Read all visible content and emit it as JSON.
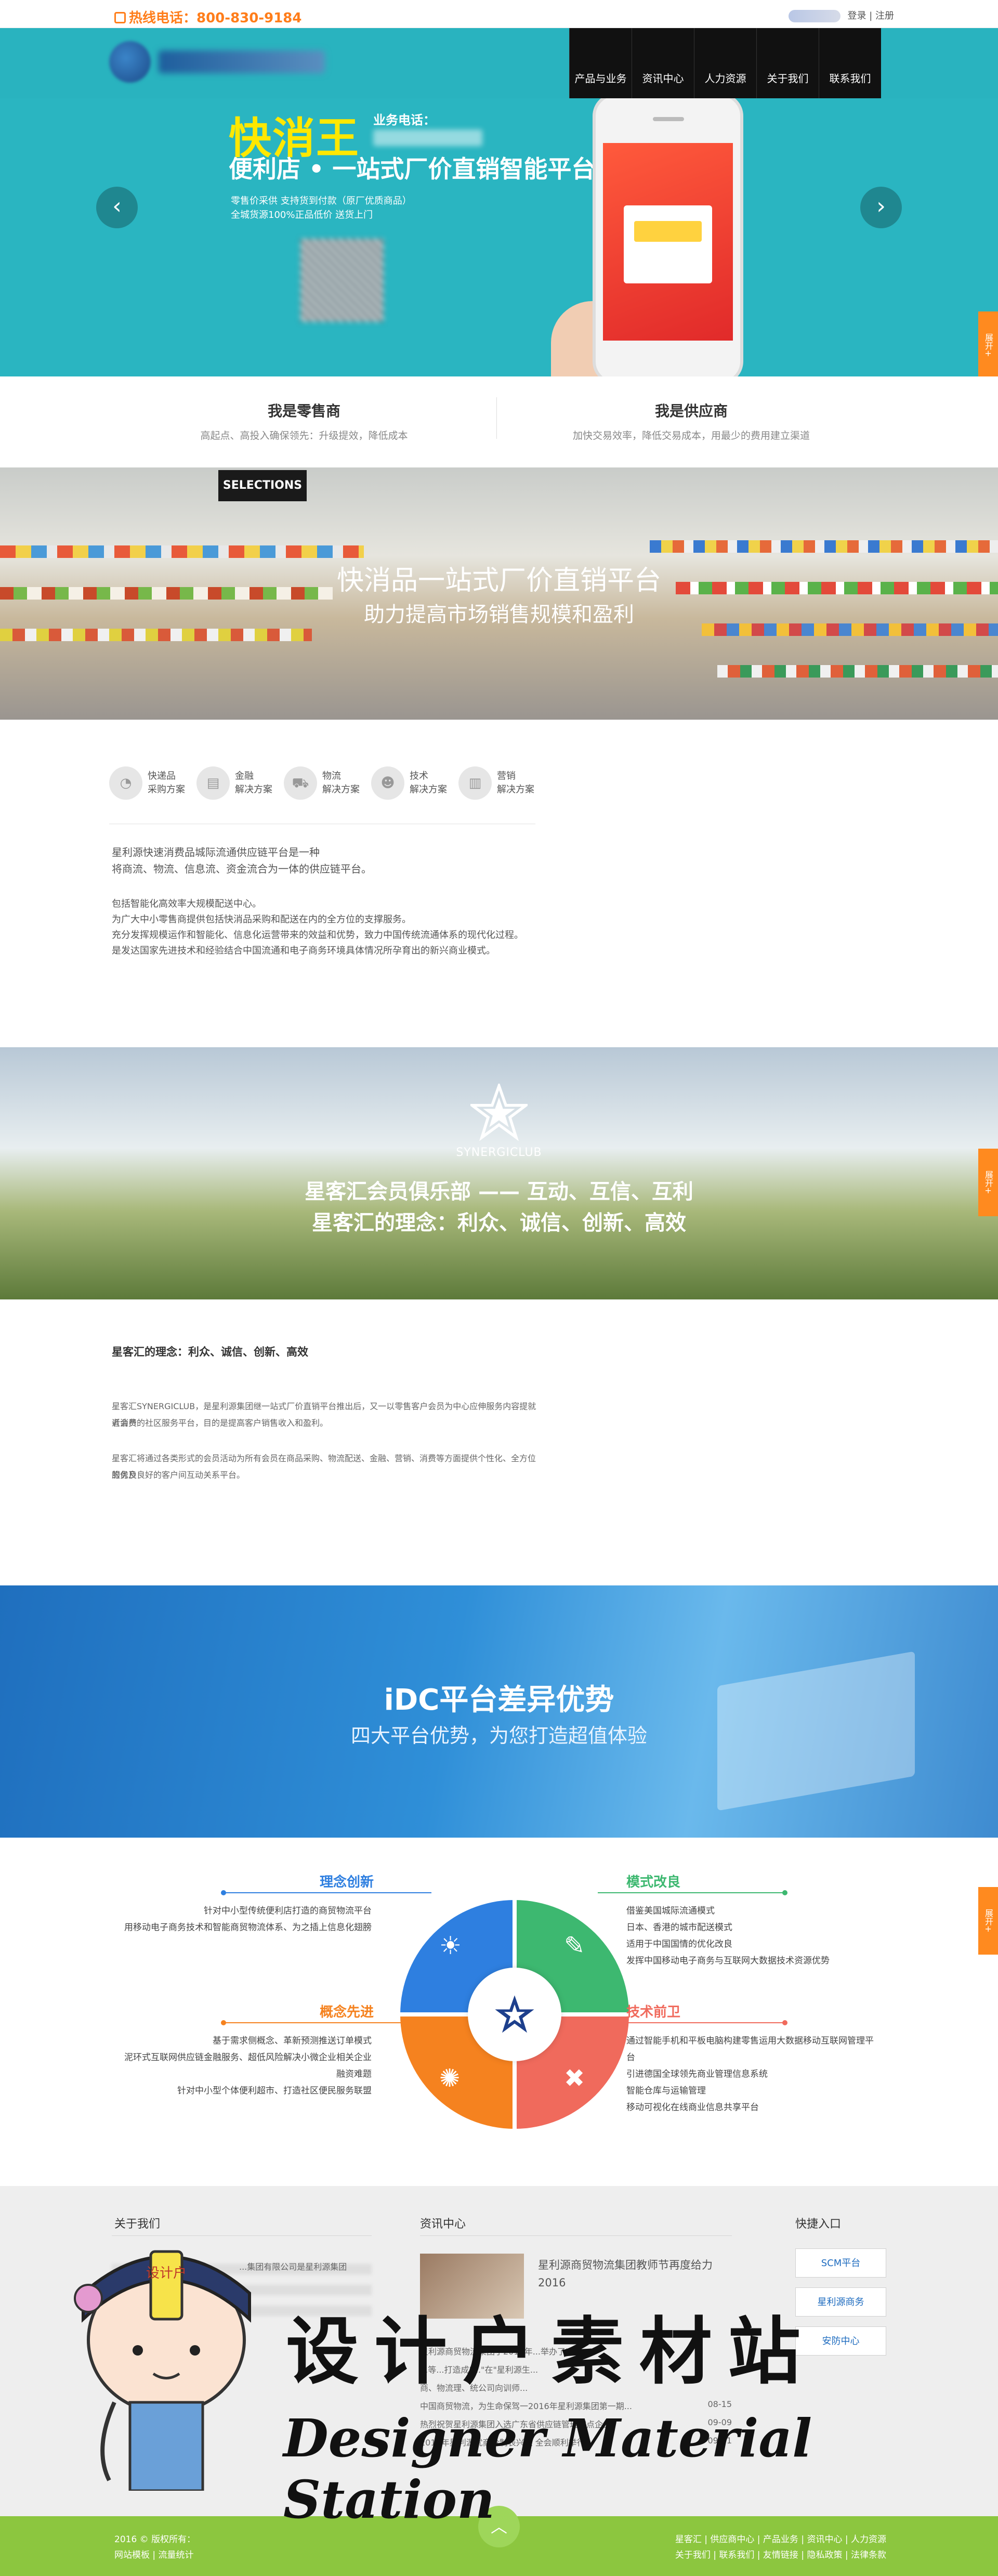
{
  "topbar": {
    "hotline": "热线电话：800-830-9184",
    "login": "登录",
    "sep": "|",
    "register": "注册"
  },
  "nav": [
    "产品与业务",
    "资讯中心",
    "人力资源",
    "关于我们",
    "联系我们"
  ],
  "hero": {
    "title": "快消王",
    "biz_label": "业务电话：",
    "subtitle": "便利店 • 一站式厂价直销智能平台",
    "line1": "零售价采供 支持货到付款（原厂优质商品）",
    "line2": "全城货源100%正品低价 送货上门",
    "prev": "‹",
    "next": "›"
  },
  "side_tab": "展开+",
  "roles": [
    {
      "title": "我是零售商",
      "desc": "高起点、高投入确保领先：升级提效，降低成本"
    },
    {
      "title": "我是供应商",
      "desc": "加快交易效率，降低交易成本，用最少的费用建立渠道"
    }
  ],
  "market_banner": {
    "sign": "SELECTIONS",
    "title": "快消品一站式厂价直销平台",
    "subtitle": "助力提高市场销售规模和盈利"
  },
  "services": {
    "items": [
      {
        "l1": "快递品",
        "l2": "采购方案"
      },
      {
        "l1": "金融",
        "l2": "解决方案"
      },
      {
        "l1": "物流",
        "l2": "解决方案"
      },
      {
        "l1": "技术",
        "l2": "解决方案"
      },
      {
        "l1": "营销",
        "l2": "解决方案"
      }
    ],
    "intro1": "星利源快速消费品城际流通供应链平台是一种",
    "intro2": "将商流、物流、信息流、资金流合为一体的供应链平台。",
    "p1": "包括智能化高效率大规模配送中心。",
    "p2": "为广大中小零售商提供包括快消品采购和配送在内的全方位的支撑服务。",
    "p3": "充分发挥规模运作和智能化、信息化运营带来的效益和优势，致力中国传统流通体系的现代化过程。",
    "p4": "是发达国家先进技术和经验结合中国流通和电子商务环境具体情况所孕育出的新兴商业模式。"
  },
  "club": {
    "brand": "SYNERGICLUB",
    "title1": "星客汇会员俱乐部 —— 互动、互信、互利",
    "title2": "星客汇的理念：利众、诚信、创新、高效",
    "heading": "星客汇的理念：利众、诚信、创新、高效",
    "p1a": "星客汇SYNERGICLUB，是星利源集团继一站式厂价直销平台推出后，又一以零售客户会员为中心应伸服务内容提就近消费",
    "p1b": "者会员的社区服务平台，目的是提高客户销售收入和盈利。",
    "p2a": "星客汇将通过各类形式的会员活动为所有会员在商品采购、物流配送、金融、营销、消费等方面提供个性化、全方位的优良",
    "p2b": "服务及良好的客户间互动关系平台。"
  },
  "idc": {
    "title": "iDC平台差异优势",
    "subtitle": "四大平台优势，为您打造超值体验"
  },
  "advantages": {
    "a1": {
      "title": "理念创新",
      "lines": [
        "针对中小型传统便利店打造的商贸物流平台",
        "用移动电子商务技术和智能商贸物流体系、为之插上信息化翅膀"
      ]
    },
    "a2": {
      "title": "模式改良",
      "lines": [
        "借鉴美国城际流通模式",
        "日本、香港的城市配送模式",
        "适用于中国国情的优化改良",
        "发挥中国移动电子商务与互联网大数据技术资源优势"
      ]
    },
    "a3": {
      "title": "概念先进",
      "lines": [
        "基于需求侧概念、革新预测推送订单模式",
        "泥环式互联网供应链金融服务、超低风险解决小微企业相关企业",
        "融资难题",
        "针对中小型个体便利超市、打造社区便民服务联盟"
      ]
    },
    "a4": {
      "title": "技术前卫",
      "lines": [
        "通过智能手机和平板电脑构建零售运用大数据移动互联网管理平",
        "台",
        "引进德国全球领先商业管理信息系统",
        "智能仓库与运输管理",
        "移动可视化在线商业信息共享平台"
      ]
    },
    "colors": {
      "blue": "#2e7fe0",
      "green": "#3db870",
      "orange": "#f5821f",
      "red": "#f06a5c"
    }
  },
  "footer": {
    "about_title": "关于我们",
    "about_snippet": "...集团有限公司是星利源集团",
    "news_title": "资讯中心",
    "news_lead": "星利源商贸物流集团教师节再度给力 2016",
    "news": [
      {
        "t": "星利源商贸物流集团于2016年...举办了\"星力",
        "d": ""
      },
      {
        "t": "...等...打造成\"...\"在\"星利源生...",
        "d": ""
      },
      {
        "t": "商、物流理、统公司向训师...",
        "d": ""
      },
      {
        "t": "中国商贸物流，为生命保驾一2016年星利源集团第一期...",
        "d": "08-15"
      },
      {
        "t": "热烈祝贺星利源集团入选广东省供应链管理试点企业！",
        "d": "09-09"
      },
      {
        "t": "2016年星利源优商价制表兴进 全会顺利举行",
        "d": "09-11"
      }
    ],
    "quick_title": "快捷入口",
    "quick": [
      "SCM平台",
      "星利源商务",
      "安防中心"
    ],
    "copyright": "2016 © 版权所有：",
    "links_left": "网站模板 | 流量统计",
    "links_right1": "星客汇 | 供应商中心 | 产品业务 | 资讯中心 | 人力资源",
    "links_right2": "关于我们 | 联系我们 | 友情链接 | 隐私政策 | 法律条款",
    "totop": "︿"
  },
  "watermark": {
    "cn": "设计户素材站",
    "en": "Designer Material Station",
    "badge": "设计户"
  }
}
